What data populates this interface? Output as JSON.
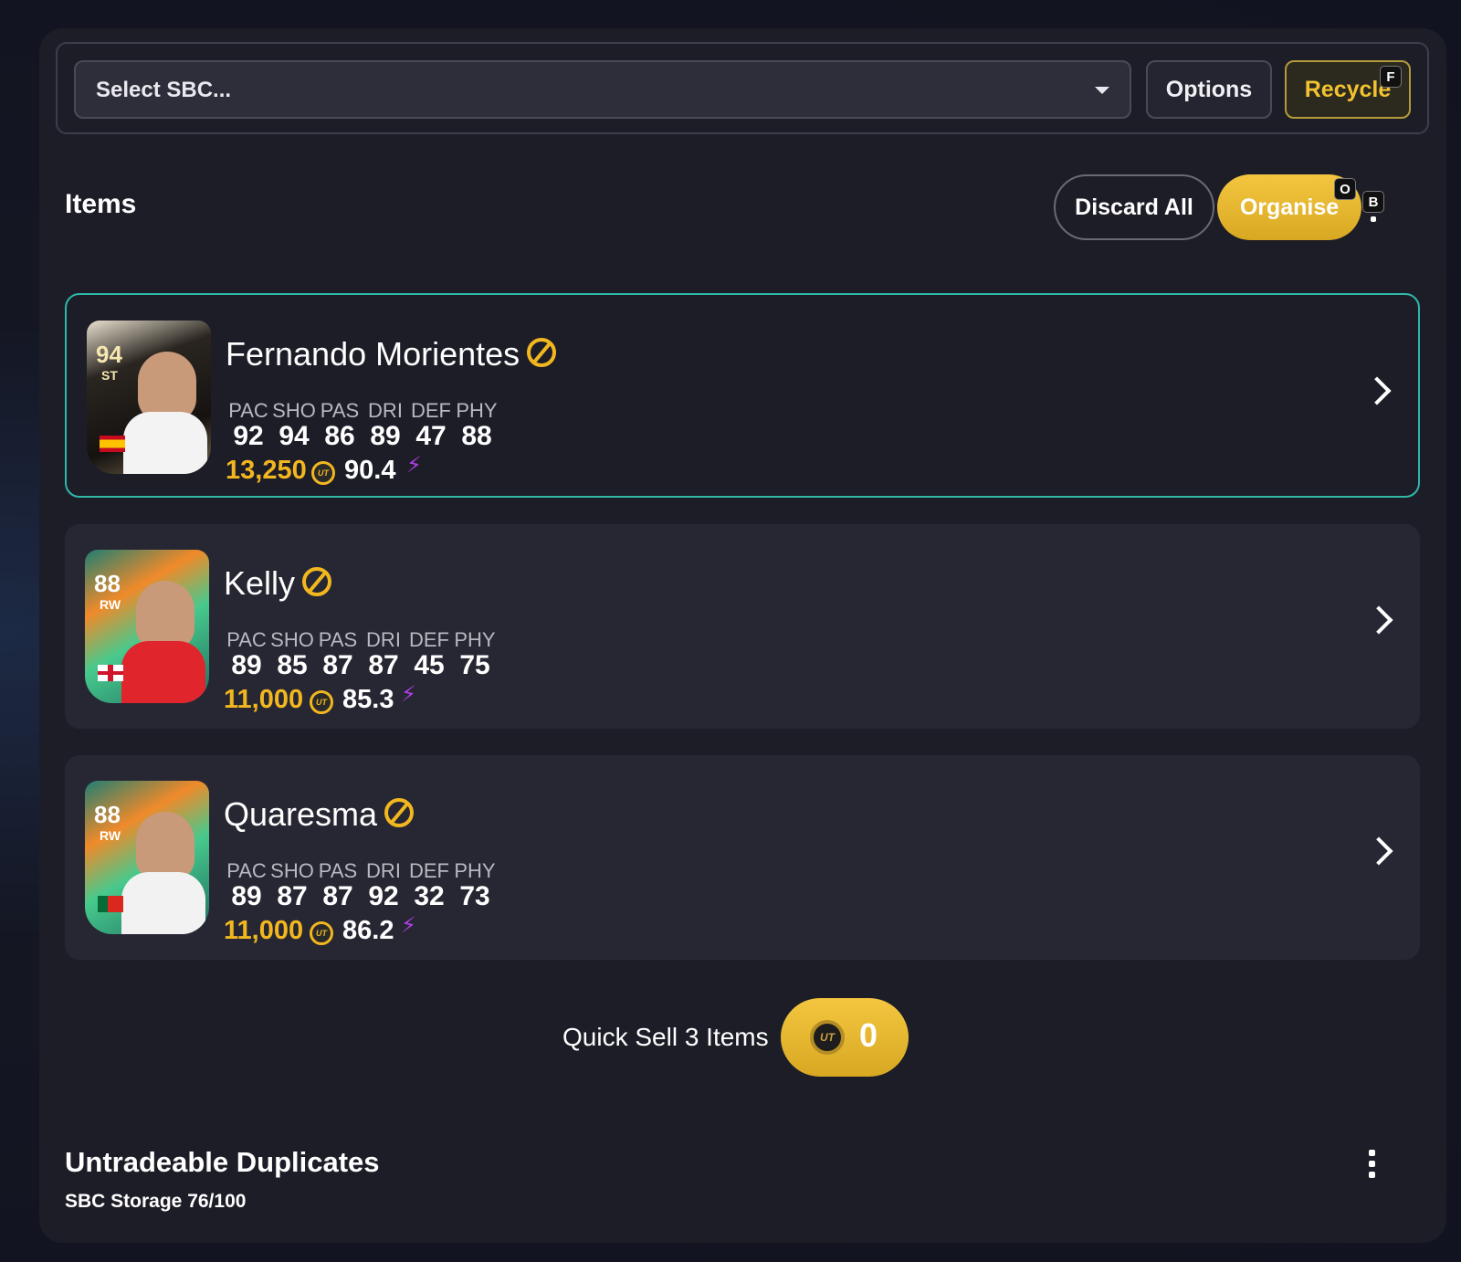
{
  "sbc": {
    "placeholder": "Select SBC...",
    "options_label": "Options",
    "recycle_label": "Recycle",
    "recycle_hotkey": "F"
  },
  "items_section": {
    "title": "Items",
    "discard_label": "Discard All",
    "organise_label": "Organise",
    "organise_hotkey": "O",
    "menu_hotkey": "B"
  },
  "stat_keys": [
    "PAC",
    "SHO",
    "PAS",
    "DRI",
    "DEF",
    "PHY"
  ],
  "players": [
    {
      "name": "Fernando Morientes",
      "card_rating": "94",
      "card_position": "ST",
      "stats": [
        "92",
        "94",
        "86",
        "89",
        "47",
        "88"
      ],
      "price": "13,250",
      "rating": "90.4"
    },
    {
      "name": "Kelly",
      "card_rating": "88",
      "card_position": "RW",
      "stats": [
        "89",
        "85",
        "87",
        "87",
        "45",
        "75"
      ],
      "price": "11,000",
      "rating": "85.3"
    },
    {
      "name": "Quaresma",
      "card_rating": "88",
      "card_position": "RW",
      "stats": [
        "89",
        "87",
        "87",
        "92",
        "32",
        "73"
      ],
      "price": "11,000",
      "rating": "86.2"
    }
  ],
  "coin_text": "UT",
  "quick_sell": {
    "label": "Quick Sell 3 Items",
    "value": "0"
  },
  "duplicates": {
    "title": "Untradeable Duplicates",
    "storage": "SBC Storage 76/100"
  },
  "colors": {
    "accent_gold": "#f2b71f",
    "selected_border": "#2fb8a8",
    "evo_purple": "#b03ee6"
  }
}
